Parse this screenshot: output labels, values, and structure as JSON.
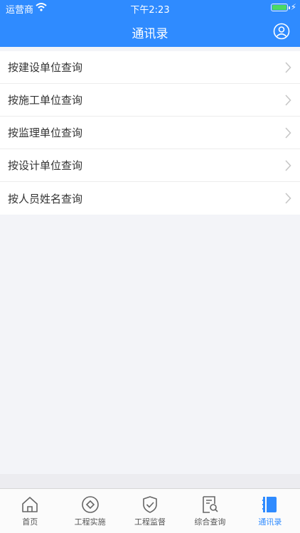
{
  "status_bar": {
    "carrier": "运营商",
    "time": "下午2:23"
  },
  "header": {
    "title": "通讯录",
    "color": "#2f8bff"
  },
  "menu": {
    "items": [
      {
        "label": "按建设单位查询"
      },
      {
        "label": "按施工单位查询"
      },
      {
        "label": "按监理单位查询"
      },
      {
        "label": "按设计单位查询"
      },
      {
        "label": "按人员姓名查询"
      }
    ]
  },
  "tabbar": {
    "items": [
      {
        "label": "首页",
        "icon": "home-icon"
      },
      {
        "label": "工程实施",
        "icon": "compass-icon"
      },
      {
        "label": "工程监督",
        "icon": "shield-check-icon"
      },
      {
        "label": "综合查询",
        "icon": "document-search-icon"
      },
      {
        "label": "通讯录",
        "icon": "contacts-book-icon",
        "active": true
      }
    ],
    "active_color": "#2f8bff"
  }
}
